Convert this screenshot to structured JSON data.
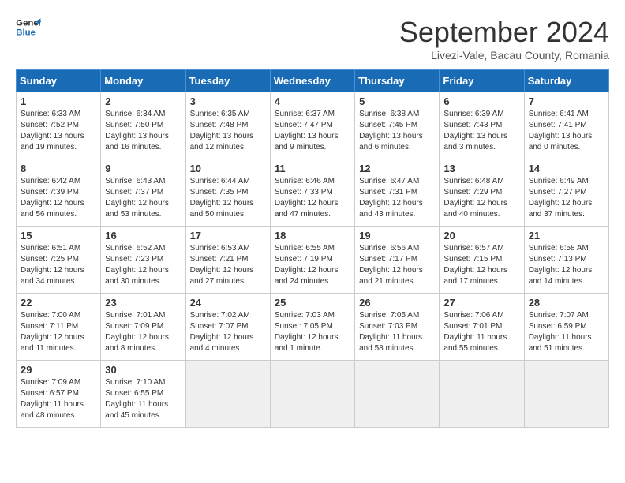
{
  "header": {
    "logo_line1": "General",
    "logo_line2": "Blue",
    "month": "September 2024",
    "location": "Livezi-Vale, Bacau County, Romania"
  },
  "weekdays": [
    "Sunday",
    "Monday",
    "Tuesday",
    "Wednesday",
    "Thursday",
    "Friday",
    "Saturday"
  ],
  "weeks": [
    [
      {
        "day": "1",
        "info": "Sunrise: 6:33 AM\nSunset: 7:52 PM\nDaylight: 13 hours\nand 19 minutes."
      },
      {
        "day": "2",
        "info": "Sunrise: 6:34 AM\nSunset: 7:50 PM\nDaylight: 13 hours\nand 16 minutes."
      },
      {
        "day": "3",
        "info": "Sunrise: 6:35 AM\nSunset: 7:48 PM\nDaylight: 13 hours\nand 12 minutes."
      },
      {
        "day": "4",
        "info": "Sunrise: 6:37 AM\nSunset: 7:47 PM\nDaylight: 13 hours\nand 9 minutes."
      },
      {
        "day": "5",
        "info": "Sunrise: 6:38 AM\nSunset: 7:45 PM\nDaylight: 13 hours\nand 6 minutes."
      },
      {
        "day": "6",
        "info": "Sunrise: 6:39 AM\nSunset: 7:43 PM\nDaylight: 13 hours\nand 3 minutes."
      },
      {
        "day": "7",
        "info": "Sunrise: 6:41 AM\nSunset: 7:41 PM\nDaylight: 13 hours\nand 0 minutes."
      }
    ],
    [
      {
        "day": "8",
        "info": "Sunrise: 6:42 AM\nSunset: 7:39 PM\nDaylight: 12 hours\nand 56 minutes."
      },
      {
        "day": "9",
        "info": "Sunrise: 6:43 AM\nSunset: 7:37 PM\nDaylight: 12 hours\nand 53 minutes."
      },
      {
        "day": "10",
        "info": "Sunrise: 6:44 AM\nSunset: 7:35 PM\nDaylight: 12 hours\nand 50 minutes."
      },
      {
        "day": "11",
        "info": "Sunrise: 6:46 AM\nSunset: 7:33 PM\nDaylight: 12 hours\nand 47 minutes."
      },
      {
        "day": "12",
        "info": "Sunrise: 6:47 AM\nSunset: 7:31 PM\nDaylight: 12 hours\nand 43 minutes."
      },
      {
        "day": "13",
        "info": "Sunrise: 6:48 AM\nSunset: 7:29 PM\nDaylight: 12 hours\nand 40 minutes."
      },
      {
        "day": "14",
        "info": "Sunrise: 6:49 AM\nSunset: 7:27 PM\nDaylight: 12 hours\nand 37 minutes."
      }
    ],
    [
      {
        "day": "15",
        "info": "Sunrise: 6:51 AM\nSunset: 7:25 PM\nDaylight: 12 hours\nand 34 minutes."
      },
      {
        "day": "16",
        "info": "Sunrise: 6:52 AM\nSunset: 7:23 PM\nDaylight: 12 hours\nand 30 minutes."
      },
      {
        "day": "17",
        "info": "Sunrise: 6:53 AM\nSunset: 7:21 PM\nDaylight: 12 hours\nand 27 minutes."
      },
      {
        "day": "18",
        "info": "Sunrise: 6:55 AM\nSunset: 7:19 PM\nDaylight: 12 hours\nand 24 minutes."
      },
      {
        "day": "19",
        "info": "Sunrise: 6:56 AM\nSunset: 7:17 PM\nDaylight: 12 hours\nand 21 minutes."
      },
      {
        "day": "20",
        "info": "Sunrise: 6:57 AM\nSunset: 7:15 PM\nDaylight: 12 hours\nand 17 minutes."
      },
      {
        "day": "21",
        "info": "Sunrise: 6:58 AM\nSunset: 7:13 PM\nDaylight: 12 hours\nand 14 minutes."
      }
    ],
    [
      {
        "day": "22",
        "info": "Sunrise: 7:00 AM\nSunset: 7:11 PM\nDaylight: 12 hours\nand 11 minutes."
      },
      {
        "day": "23",
        "info": "Sunrise: 7:01 AM\nSunset: 7:09 PM\nDaylight: 12 hours\nand 8 minutes."
      },
      {
        "day": "24",
        "info": "Sunrise: 7:02 AM\nSunset: 7:07 PM\nDaylight: 12 hours\nand 4 minutes."
      },
      {
        "day": "25",
        "info": "Sunrise: 7:03 AM\nSunset: 7:05 PM\nDaylight: 12 hours\nand 1 minute."
      },
      {
        "day": "26",
        "info": "Sunrise: 7:05 AM\nSunset: 7:03 PM\nDaylight: 11 hours\nand 58 minutes."
      },
      {
        "day": "27",
        "info": "Sunrise: 7:06 AM\nSunset: 7:01 PM\nDaylight: 11 hours\nand 55 minutes."
      },
      {
        "day": "28",
        "info": "Sunrise: 7:07 AM\nSunset: 6:59 PM\nDaylight: 11 hours\nand 51 minutes."
      }
    ],
    [
      {
        "day": "29",
        "info": "Sunrise: 7:09 AM\nSunset: 6:57 PM\nDaylight: 11 hours\nand 48 minutes."
      },
      {
        "day": "30",
        "info": "Sunrise: 7:10 AM\nSunset: 6:55 PM\nDaylight: 11 hours\nand 45 minutes."
      },
      {
        "day": "",
        "info": ""
      },
      {
        "day": "",
        "info": ""
      },
      {
        "day": "",
        "info": ""
      },
      {
        "day": "",
        "info": ""
      },
      {
        "day": "",
        "info": ""
      }
    ]
  ]
}
